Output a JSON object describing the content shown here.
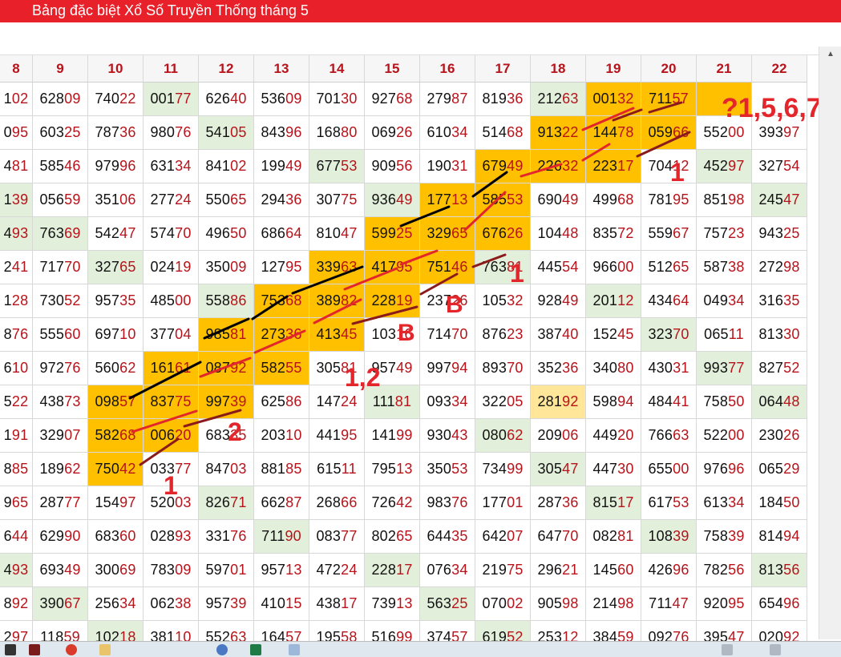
{
  "header": {
    "title": "Bảng đặc biệt Xổ Số Truyền Thống tháng 5"
  },
  "columns": [
    "8",
    "9",
    "10",
    "11",
    "12",
    "13",
    "14",
    "15",
    "16",
    "17",
    "18",
    "19",
    "20",
    "21",
    "22"
  ],
  "rows": [
    [
      "102",
      "62809",
      "74022",
      "00177",
      "62640",
      "53609",
      "70130",
      "92768",
      "27987",
      "81936",
      "21263",
      "00132",
      "71157",
      "",
      ""
    ],
    [
      "095",
      "60325",
      "78736",
      "98076",
      "54105",
      "84396",
      "16880",
      "06926",
      "61034",
      "51468",
      "91322",
      "14478",
      "05966",
      "55200",
      "39397"
    ],
    [
      "481",
      "58546",
      "97996",
      "63134",
      "84102",
      "19949",
      "67753",
      "90956",
      "19031",
      "67949",
      "22632",
      "22317",
      "70412",
      "45297",
      "32754"
    ],
    [
      "139",
      "05659",
      "35106",
      "27724",
      "55065",
      "29436",
      "30775",
      "93649",
      "17713",
      "58553",
      "69049",
      "49968",
      "78195",
      "85198",
      "24547"
    ],
    [
      "493",
      "76369",
      "54247",
      "57470",
      "49650",
      "68664",
      "81047",
      "59925",
      "32965",
      "67626",
      "10448",
      "83572",
      "55967",
      "75723",
      "94325"
    ],
    [
      "241",
      "71770",
      "32765",
      "02419",
      "35009",
      "12795",
      "33963",
      "41795",
      "75146",
      "76381",
      "44554",
      "96600",
      "51265",
      "58738",
      "27298"
    ],
    [
      "128",
      "73052",
      "95735",
      "48500",
      "55886",
      "75368",
      "38982",
      "22819",
      "23726",
      "10532",
      "92849",
      "20112",
      "43464",
      "04934",
      "31635"
    ],
    [
      "876",
      "55560",
      "69710",
      "37704",
      "98581",
      "27336",
      "41345",
      "10316",
      "71470",
      "87623",
      "38740",
      "15245",
      "32370",
      "06511",
      "81330"
    ],
    [
      "610",
      "97276",
      "56062",
      "16161",
      "08792",
      "58255",
      "30581",
      "95749",
      "99794",
      "89370",
      "35236",
      "34080",
      "43031",
      "99377",
      "82752"
    ],
    [
      "522",
      "43873",
      "09857",
      "83775",
      "99739",
      "62586",
      "14724",
      "11181",
      "09334",
      "32205",
      "28192",
      "59894",
      "48441",
      "75850",
      "06448"
    ],
    [
      "191",
      "32907",
      "58268",
      "00620",
      "68335",
      "20310",
      "44195",
      "14199",
      "93043",
      "08062",
      "20906",
      "44920",
      "76663",
      "52200",
      "23026"
    ],
    [
      "885",
      "18962",
      "75042",
      "03377",
      "84703",
      "88185",
      "61511",
      "79513",
      "35053",
      "73499",
      "30547",
      "44730",
      "65500",
      "97696",
      "06529"
    ],
    [
      "965",
      "28777",
      "15497",
      "52003",
      "82671",
      "66287",
      "26866",
      "72642",
      "98376",
      "17701",
      "28736",
      "81517",
      "61753",
      "61334",
      "18450"
    ],
    [
      "644",
      "62990",
      "68360",
      "02893",
      "33176",
      "71190",
      "08377",
      "80265",
      "64435",
      "64207",
      "64770",
      "08281",
      "10839",
      "75839",
      "81494"
    ],
    [
      "493",
      "69349",
      "30069",
      "78309",
      "59701",
      "95713",
      "47224",
      "22817",
      "07634",
      "21975",
      "29621",
      "14560",
      "42696",
      "78256",
      "81356"
    ],
    [
      "892",
      "39067",
      "25634",
      "06238",
      "95739",
      "41015",
      "43817",
      "73913",
      "56325",
      "07002",
      "90598",
      "21498",
      "71147",
      "92095",
      "65496"
    ],
    [
      "297",
      "11859",
      "10218",
      "38110",
      "55263",
      "16457",
      "19558",
      "51699",
      "37457",
      "61952",
      "25312",
      "38459",
      "09276",
      "39547",
      "02092"
    ]
  ],
  "annotations": {
    "top_right": "?1,5,6,7",
    "label_1_a": "1",
    "label_1_b": "1",
    "label_1_c": "1",
    "label_b_a": "B",
    "label_b_b": "B",
    "label_12": "1,2",
    "label_2": "2"
  },
  "colors": {
    "header_red": "#e8202a",
    "highlight_orange": "#ffc000",
    "highlight_green": "#e2efda",
    "highlight_light": "#ffe699",
    "last_digits_red": "#b8131a",
    "annotation_red": "#e3262c",
    "line_black": "#000000",
    "line_darkred": "#8b1a1a"
  }
}
